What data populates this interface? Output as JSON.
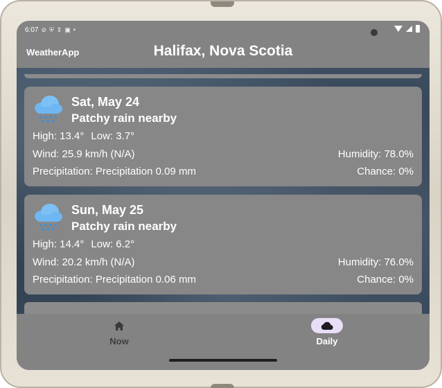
{
  "status_bar": {
    "time": "6:07",
    "icons": [
      "sync-icon",
      "shield-icon",
      "vpn-icon",
      "sim-icon",
      "dot-icon"
    ]
  },
  "app_bar": {
    "app_name": "WeatherApp",
    "location": "Halifax, Nova Scotia"
  },
  "forecast": [
    {
      "day": "Sat, May 24",
      "condition": "Patchy rain nearby",
      "high": "High: 13.4°",
      "low": "Low: 3.7°",
      "wind": "Wind: 25.9 km/h (N/A)",
      "humidity": "Humidity: 78.0%",
      "precipitation": "Precipitation: Precipitation 0.09 mm",
      "chance": "Chance: 0%"
    },
    {
      "day": "Sun, May 25",
      "condition": "Patchy rain nearby",
      "high": "High: 14.4°",
      "low": "Low: 6.2°",
      "wind": "Wind: 20.2 km/h (N/A)",
      "humidity": "Humidity: 76.0%",
      "precipitation": "Precipitation: Precipitation 0.06 mm",
      "chance": "Chance: 0%"
    }
  ],
  "bottom_nav": {
    "items": [
      {
        "label": "Now",
        "icon": "home-icon",
        "active": false
      },
      {
        "label": "Daily",
        "icon": "cloud-icon",
        "active": true
      }
    ]
  },
  "colors": {
    "surface": "#838383",
    "card": "#878787",
    "active_indicator": "#e8def8",
    "rain_icon": "#6fb7f2"
  }
}
